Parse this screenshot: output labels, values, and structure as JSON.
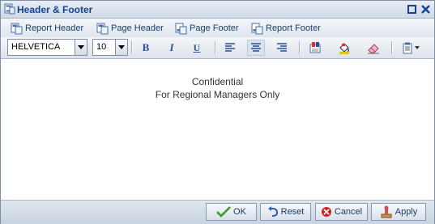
{
  "window": {
    "title": "Header & Footer"
  },
  "tabs": [
    {
      "label": "Report Header"
    },
    {
      "label": "Page Header"
    },
    {
      "label": "Page Footer"
    },
    {
      "label": "Report Footer"
    }
  ],
  "toolbar": {
    "font_family": "HELVETICA",
    "font_size": "10",
    "bold_label": "B",
    "italic_label": "I",
    "underline_label": "U"
  },
  "content": {
    "lines": [
      "Confidential",
      "For Regional Managers Only"
    ]
  },
  "footer": {
    "ok_label": "OK",
    "reset_label": "Reset",
    "cancel_label": "Cancel",
    "apply_label": "Apply"
  },
  "colors": {
    "title_text": "#15428b",
    "ok_check": "#3a9a2a",
    "cancel_red": "#d02020"
  }
}
